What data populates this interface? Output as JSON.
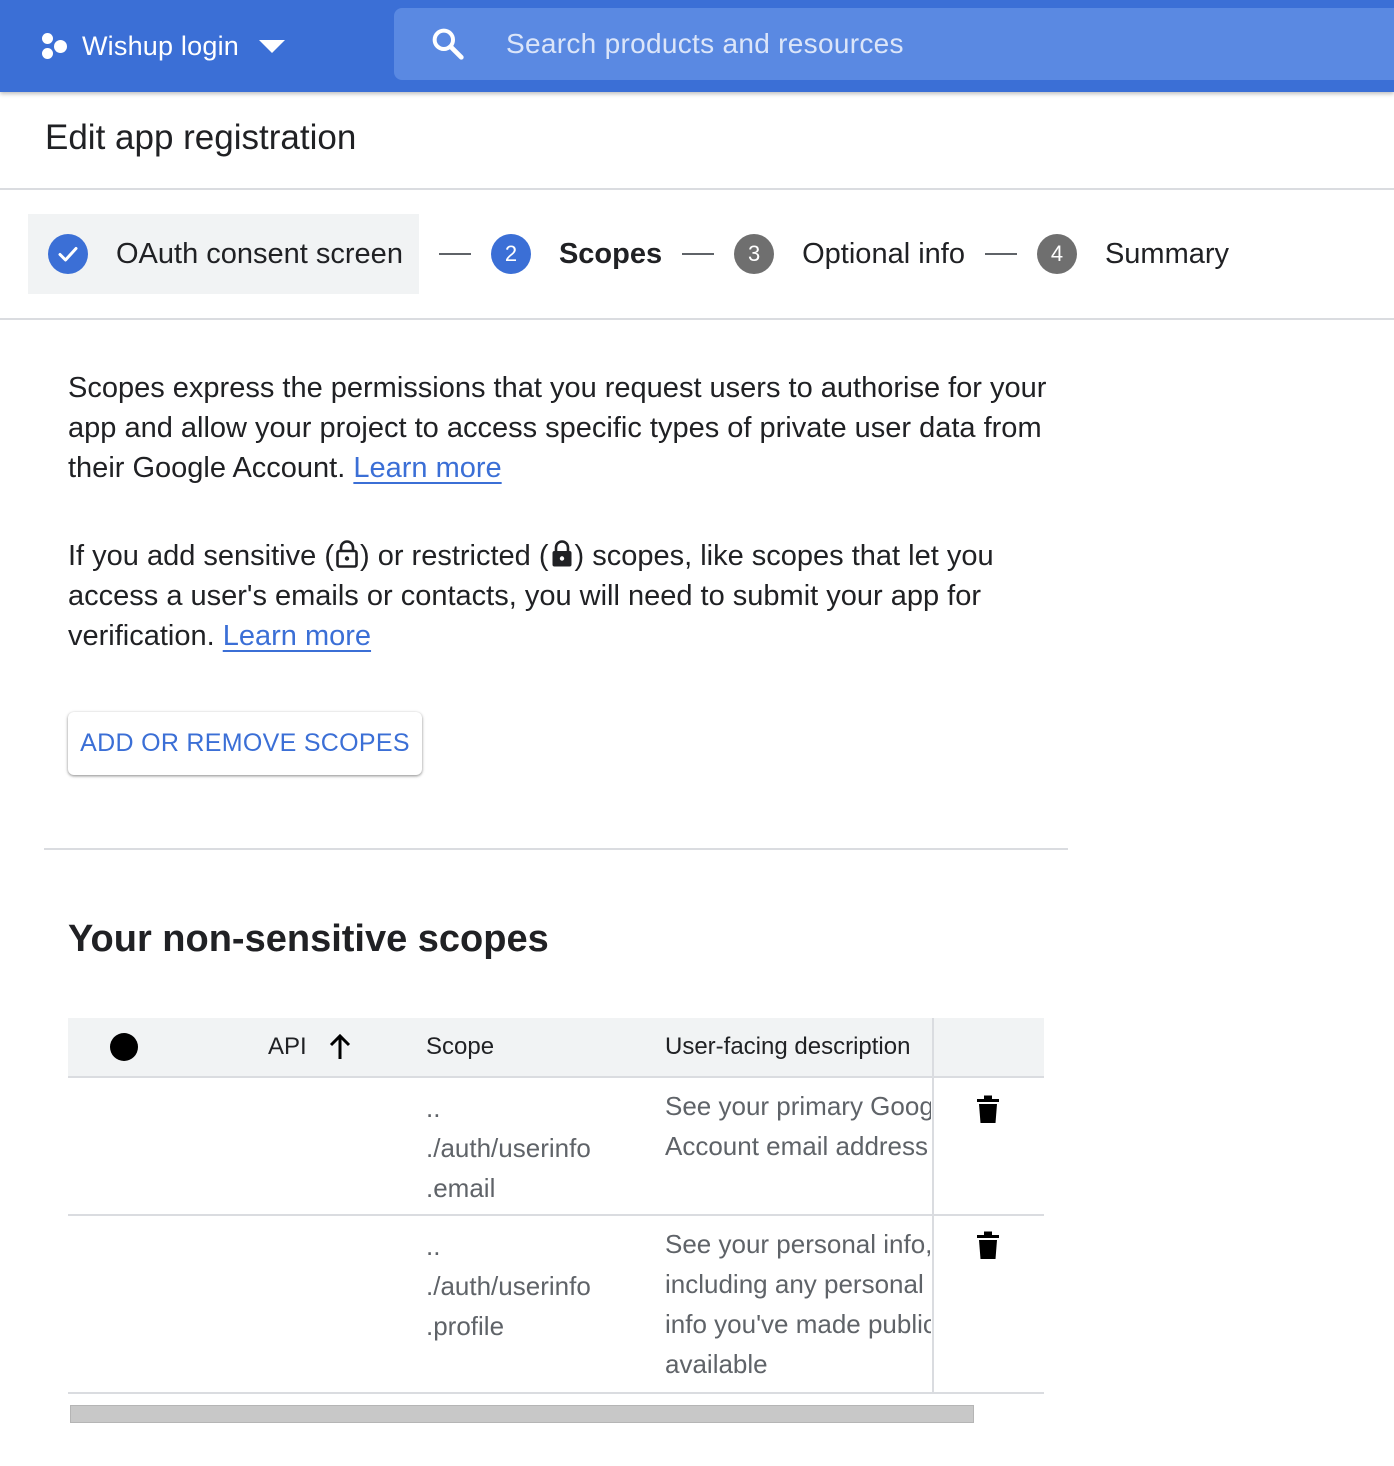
{
  "header": {
    "project_name": "Wishup login",
    "search_placeholder": "Search products and resources"
  },
  "page": {
    "title": "Edit app registration"
  },
  "stepper": {
    "steps": [
      {
        "number": "",
        "label": "OAuth consent screen",
        "state": "completed"
      },
      {
        "number": "2",
        "label": "Scopes",
        "state": "active"
      },
      {
        "number": "3",
        "label": "Optional info",
        "state": "pending"
      },
      {
        "number": "4",
        "label": "Summary",
        "state": "pending"
      }
    ]
  },
  "intro": {
    "para1_text": "Scopes express the permissions that you request users to authorise for your app and allow your project to access specific types of private user data from their Google Account.",
    "para1_link": "Learn more",
    "para2_before_sensitive": "If you add sensitive (",
    "para2_between": ") or restricted (",
    "para2_after": ") scopes, like scopes that let you access a user's emails or contacts, you will need to submit your app for verification.",
    "para2_link": "Learn more"
  },
  "actions": {
    "add_remove_scopes": "ADD OR REMOVE SCOPES"
  },
  "non_sensitive": {
    "title": "Your non-sensitive scopes",
    "columns": {
      "api": "API",
      "scope": "Scope",
      "description": "User-facing description"
    },
    "rows": [
      {
        "api": "",
        "scope_lines": [
          "..",
          "./auth/userinfo",
          ".email"
        ],
        "description_lines": [
          "See your primary Googl",
          "Account email address"
        ]
      },
      {
        "api": "",
        "scope_lines": [
          "..",
          "./auth/userinfo",
          ".profile"
        ],
        "description_lines": [
          "See your personal info,",
          "including any personal",
          "info you've made public",
          "available"
        ]
      }
    ]
  },
  "icons": {
    "project": "project-hex-icon",
    "caret": "arrow-drop-down-icon",
    "search": "search-icon",
    "check": "check-circle-icon",
    "lock_open": "lock-outline-icon",
    "lock": "lock-icon",
    "sort": "arrow-up-icon",
    "delete": "trash-icon"
  },
  "colors": {
    "brand_blue": "#3b6fd6",
    "header_bg": "#3b6fd6",
    "search_bg": "#5a89e2",
    "step_done_bg": "#f1f3f4",
    "step_pending": "#6f6f6f"
  }
}
